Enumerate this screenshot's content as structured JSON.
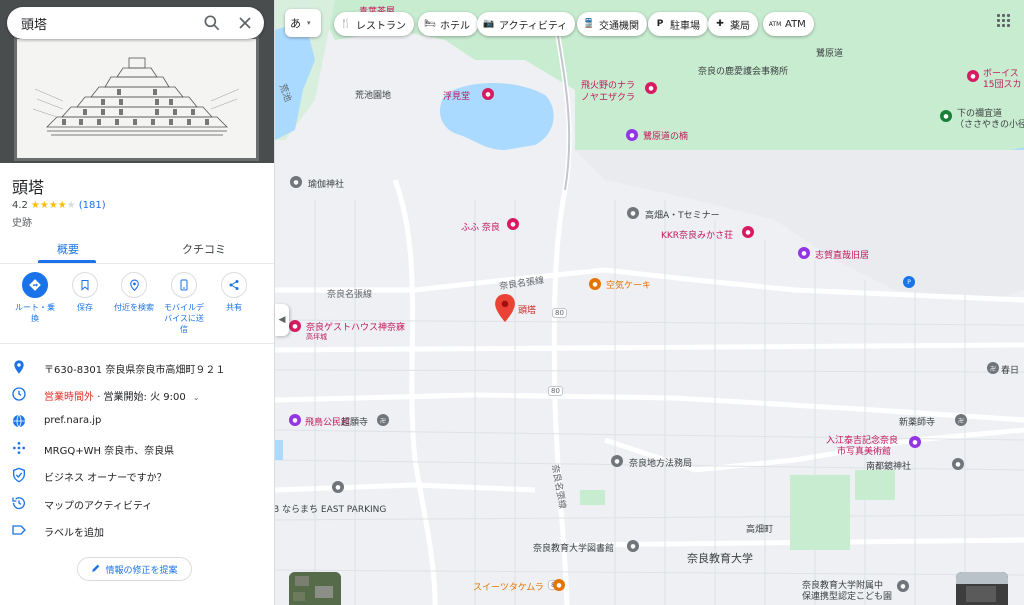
{
  "search": {
    "value": "頭塔"
  },
  "place": {
    "title": "頭塔",
    "rating": "4.2",
    "rating_value": 4.2,
    "review_count": "(181)",
    "category": "史跡"
  },
  "tabs": [
    {
      "label": "概要"
    },
    {
      "label": "クチコミ"
    }
  ],
  "actions": [
    {
      "label_line1": "ルート・乗",
      "label_line2": "換",
      "icon": "directions-icon"
    },
    {
      "label_line1": "保存",
      "label_line2": "",
      "icon": "bookmark-icon"
    },
    {
      "label_line1": "付近を検索",
      "label_line2": "",
      "icon": "nearby-icon"
    },
    {
      "label_line1": "モバイルデ",
      "label_line2": "バイスに送",
      "label_line3": "信",
      "icon": "phone-icon"
    },
    {
      "label_line1": "共有",
      "label_line2": "",
      "icon": "share-icon"
    }
  ],
  "info": {
    "address": "〒630-8301 奈良県奈良市高畑町９２１",
    "hours_closed": "営業時間外",
    "hours_open": "· 営業開始: 火 9:00",
    "website": "pref.nara.jp",
    "plus_code": "MRGQ+WH 奈良市、奈良県",
    "owner": "ビジネス オーナーですか？",
    "activity": "マップのアクティビティ",
    "label": "ラベルを追加"
  },
  "suggest_edit": "情報の修正を提案",
  "map": {
    "lang_button": "あ",
    "chips": [
      {
        "label": "レストラン",
        "icon": "restaurant-icon"
      },
      {
        "label": "ホテル",
        "icon": "hotel-icon"
      },
      {
        "label": "アクティビティ",
        "icon": "camera-icon"
      },
      {
        "label": "交通機関",
        "icon": "transit-icon"
      },
      {
        "label": "駐車場",
        "icon": "parking-icon"
      },
      {
        "label": "薬局",
        "icon": "pharmacy-icon"
      },
      {
        "label": "ATM",
        "icon": "atm-icon"
      }
    ],
    "labels": {
      "aoba": "青葉茶屋",
      "sagi": "鷺原道",
      "araike": "荒池園地",
      "ukimido": "浮見堂",
      "tobihino": "飛火野のナラ",
      "noyaezakura": "ノヤエザクラ",
      "shikaaigo": "奈良の鹿愛護会事務所",
      "sagihara_bashi": "鷺原道の楠",
      "shimo_mikado": "下の禰宜道",
      "sasayaki": "（ささやきの小径）",
      "boy_scout": "ボーイス",
      "boy_scout2": "15団スカ",
      "yuge": "瑜伽神社",
      "fufu": "ふふ 奈良",
      "takabatake_seminar": "高畑A・Tセミナー",
      "kkr": "KKR奈良みかさ荘",
      "shiga": "志賀直哉旧居",
      "kuki": "空気ケーキ",
      "zuto": "頭塔",
      "guesthouse": "奈良ゲストハウス神奈寐",
      "kaminami_sub": "高坪城",
      "asuka": "飛鳥公民館",
      "chogan": "超願寺",
      "shinyakushiji": "新薬師寺",
      "irie": "入江泰吉記念奈良",
      "irie2": "市写真美術館",
      "nanto": "南都鏡神社",
      "chiho": "奈良地方法務局",
      "naramachi": "B ならまち EAST PARKING",
      "takabatake_cho": "高畑町",
      "library": "奈良教育大学図書館",
      "kyoiku": "奈良教育大学",
      "sweets": "スイーツタケムラ",
      "fuzoku": "奈良教育大学附属中",
      "fuzoku2": "保連携型認定こども園",
      "kasuga": "春日",
      "road_narana": "奈良名張線",
      "road_narana2": "奈良名張線",
      "road_narana3": "奈良名張線",
      "road_80": "80",
      "road_80b": "80",
      "road_80c": "80",
      "koike": "荒池"
    }
  },
  "colors": {
    "accent": "#1a73e8",
    "closed": "#d93025",
    "star": "#fbbc04",
    "park": "#c8ecd0",
    "water": "#aadaff",
    "pin": "#ea4335"
  }
}
